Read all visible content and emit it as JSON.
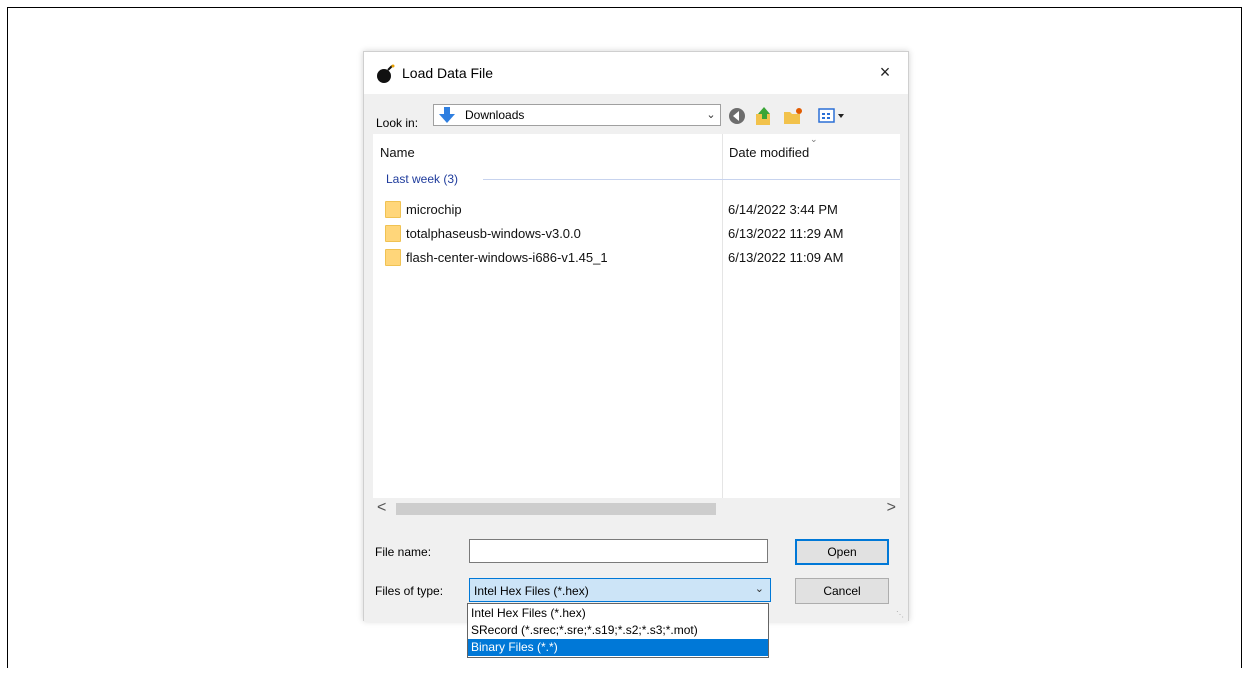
{
  "dialog": {
    "title": "Load Data File",
    "close_glyph": "×",
    "title_icon": "bomb-app-icon"
  },
  "lookin": {
    "label": "Look in:",
    "value": "Downloads",
    "icon": "downloads-arrow-icon"
  },
  "toolbar": {
    "back_icon": "back-icon",
    "up_icon": "up-folder-icon",
    "newfolder_icon": "new-folder-icon",
    "view_icon": "view-menu-icon"
  },
  "file_list": {
    "headers": {
      "name": "Name",
      "date": "Date modified"
    },
    "group": "Last week (3)",
    "rows": [
      {
        "name": "microchip",
        "date": "6/14/2022 3:44 PM"
      },
      {
        "name": "totalphaseusb-windows-v3.0.0",
        "date": "6/13/2022 11:29 AM"
      },
      {
        "name": "flash-center-windows-i686-v1.45_1",
        "date": "6/13/2022 11:09 AM"
      }
    ],
    "scroll_left": "<",
    "scroll_right": ">"
  },
  "filename": {
    "label": "File name:",
    "value": ""
  },
  "filetype": {
    "label": "Files of type:",
    "value": "Intel Hex Files (*.hex)",
    "options": [
      "Intel Hex Files (*.hex)",
      "SRecord (*.srec;*.sre;*.s19;*.s2;*.s3;*.mot)",
      "Binary Files (*.*)"
    ],
    "highlighted_index": 2
  },
  "buttons": {
    "open": "Open",
    "cancel": "Cancel"
  },
  "colors": {
    "accent": "#0078d7",
    "folder": "#ffd67a",
    "group_text": "#1e3b9c"
  }
}
